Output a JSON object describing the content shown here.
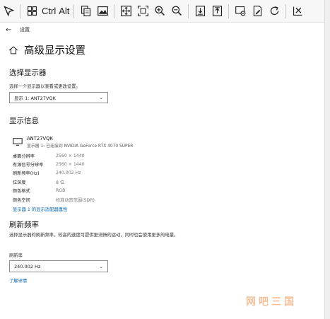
{
  "toolbar": {
    "ctrl_label": "Ctrl",
    "alt_label": "Alt"
  },
  "nav": {
    "back_glyph": "←",
    "title": "设置"
  },
  "page": {
    "title": "高级显示设置"
  },
  "select_display": {
    "heading": "选择显示器",
    "hint": "选择一个显示器以查看或更改设置。",
    "selected": "显示 1: ANT27VQK"
  },
  "display_info": {
    "heading": "显示信息",
    "monitor_name": "ANT27VQK",
    "monitor_sub": "显示器 1: 已连接到 NVIDIA GeForce RTX 4070 SUPER",
    "rows": [
      {
        "label": "桌面分辨率",
        "value": "2560 × 1440"
      },
      {
        "label": "有源信号分辨率",
        "value": "2560 × 1440"
      },
      {
        "label": "刷新频率(Hz)",
        "value": "240.002 Hz"
      },
      {
        "label": "位深度",
        "value": "8 位"
      },
      {
        "label": "颜色格式",
        "value": "RGB"
      },
      {
        "label": "颜色空间",
        "value": "标准动态范围(SDR)"
      }
    ],
    "adapter_link": "显示器 1 的显示适配器属性"
  },
  "refresh": {
    "heading": "刷新频率",
    "description": "选择显示器的刷新频率。较高的速度可提供更流畅的运动，同时也会使用更多的电量。",
    "field_label": "刷新率",
    "selected": "240.002 Hz",
    "learn_more": "了解详情"
  },
  "watermark": "网吧三国"
}
